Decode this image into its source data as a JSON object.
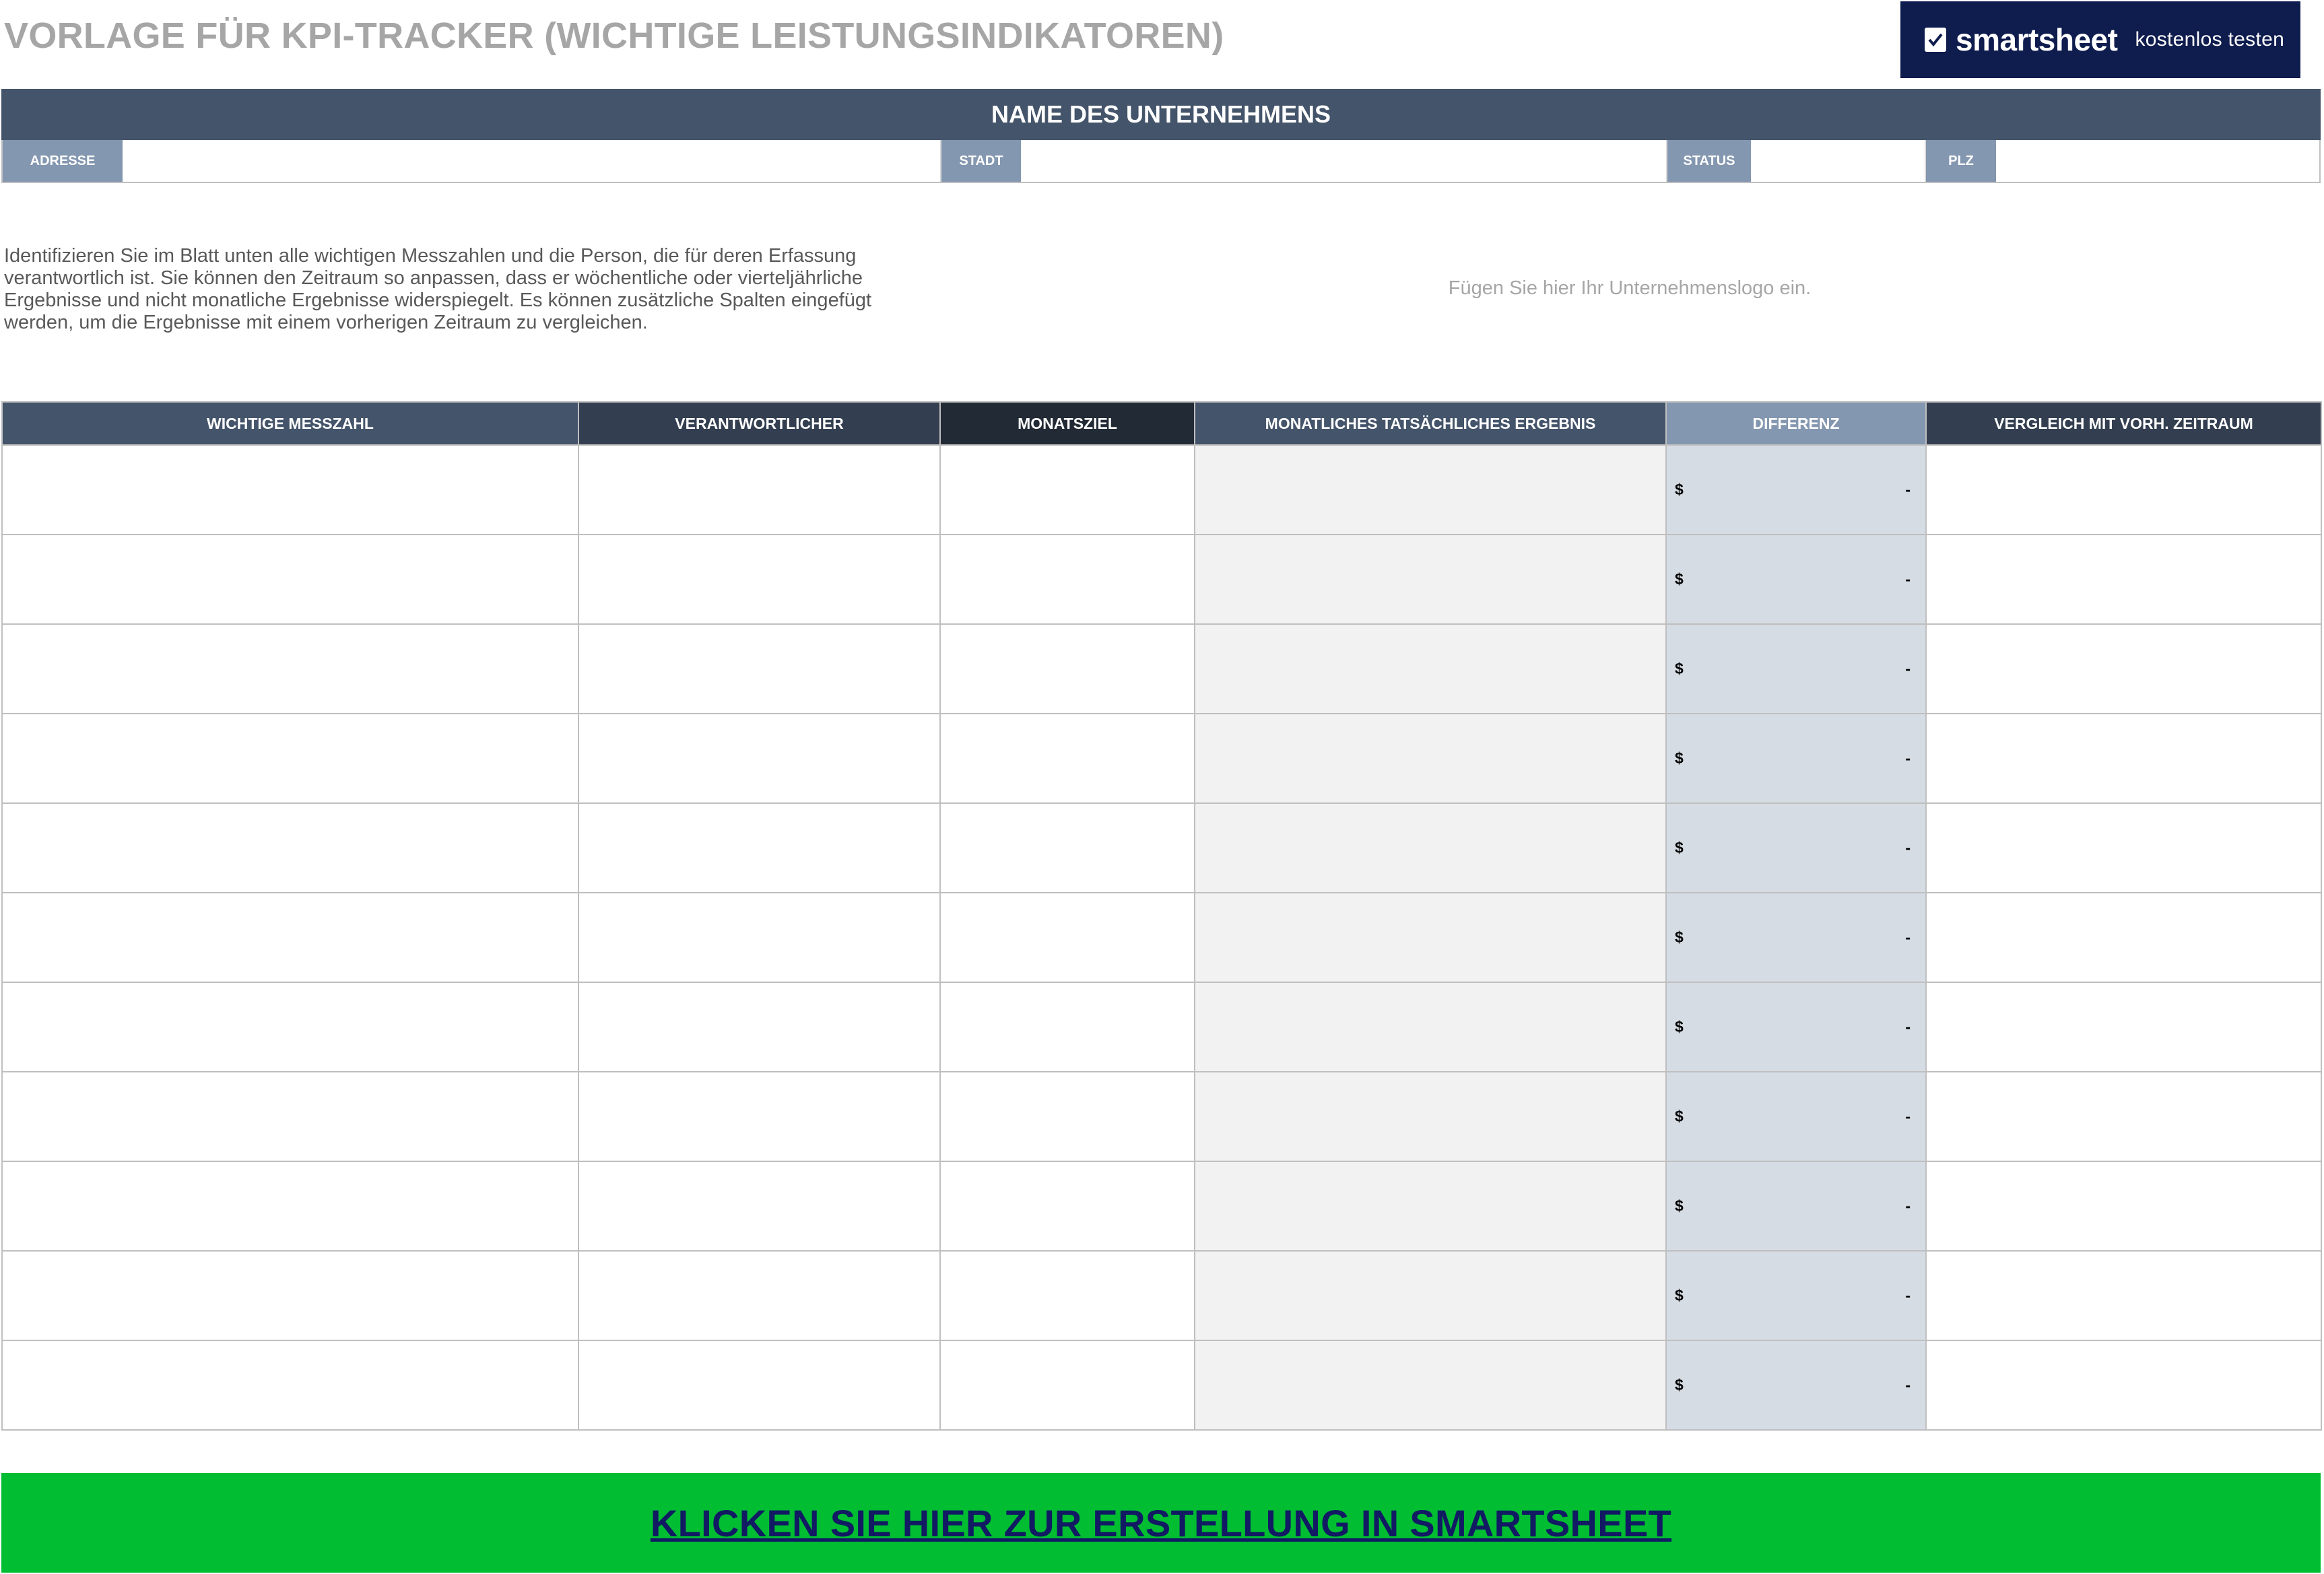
{
  "title": "VORLAGE FÜR KPI-TRACKER (WICHTIGE LEISTUNGSINDIKATOREN)",
  "smartsheet_banner": {
    "brand": "smartsheet",
    "cta": "kostenlos testen",
    "background": "#0f1c4e",
    "icon": "check-icon"
  },
  "company": {
    "name_label": "NAME DES UNTERNEHMENS",
    "fields": [
      {
        "label": "ADRESSE",
        "value": ""
      },
      {
        "label": "STADT",
        "value": ""
      },
      {
        "label": "STATUS",
        "value": ""
      },
      {
        "label": "PLZ",
        "value": ""
      }
    ]
  },
  "description": "Identifizieren Sie im Blatt unten alle wichtigen Messzahlen und die Person, die für deren Erfassung verantwortlich ist. Sie können den Zeitraum so anpassen, dass er wöchentliche oder vierteljährliche Ergebnisse und nicht monatliche Ergebnisse widerspiegelt. Es können zusätzliche Spalten eingefügt werden, um die Ergebnisse mit einem vorherigen Zeitraum zu vergleichen.",
  "logo_placeholder": "Fügen Sie hier Ihr Unternehmenslogo ein.",
  "table": {
    "headers": [
      "WICHTIGE MESSZAHL",
      "VERANTWORTLICHER",
      "MONATSZIEL",
      "MONATLICHES TATSÄCHLICHES ERGEBNIS",
      "DIFFERENZ",
      "VERGLEICH MIT VORH. ZEITRAUM"
    ],
    "header_colors": [
      "#44546a",
      "#333f50",
      "#222a35",
      "#44546a",
      "#8497b0",
      "#333f50"
    ],
    "rows": [
      {
        "metric": "",
        "owner": "",
        "target": "",
        "actual": "",
        "currency": "$",
        "difference": "-",
        "comparison": ""
      },
      {
        "metric": "",
        "owner": "",
        "target": "",
        "actual": "",
        "currency": "$",
        "difference": "-",
        "comparison": ""
      },
      {
        "metric": "",
        "owner": "",
        "target": "",
        "actual": "",
        "currency": "$",
        "difference": "-",
        "comparison": ""
      },
      {
        "metric": "",
        "owner": "",
        "target": "",
        "actual": "",
        "currency": "$",
        "difference": "-",
        "comparison": ""
      },
      {
        "metric": "",
        "owner": "",
        "target": "",
        "actual": "",
        "currency": "$",
        "difference": "-",
        "comparison": ""
      },
      {
        "metric": "",
        "owner": "",
        "target": "",
        "actual": "",
        "currency": "$",
        "difference": "-",
        "comparison": ""
      },
      {
        "metric": "",
        "owner": "",
        "target": "",
        "actual": "",
        "currency": "$",
        "difference": "-",
        "comparison": ""
      },
      {
        "metric": "",
        "owner": "",
        "target": "",
        "actual": "",
        "currency": "$",
        "difference": "-",
        "comparison": ""
      },
      {
        "metric": "",
        "owner": "",
        "target": "",
        "actual": "",
        "currency": "$",
        "difference": "-",
        "comparison": ""
      },
      {
        "metric": "",
        "owner": "",
        "target": "",
        "actual": "",
        "currency": "$",
        "difference": "-",
        "comparison": ""
      },
      {
        "metric": "",
        "owner": "",
        "target": "",
        "actual": "",
        "currency": "$",
        "difference": "-",
        "comparison": ""
      }
    ]
  },
  "cta": {
    "label": "KLICKEN SIE HIER ZUR ERSTELLUNG IN SMARTSHEET",
    "background": "#00bd32",
    "text_color": "#111a63"
  }
}
